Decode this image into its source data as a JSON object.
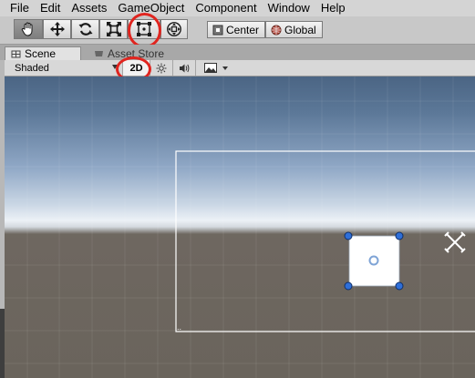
{
  "menu": [
    "File",
    "Edit",
    "Assets",
    "GameObject",
    "Component",
    "Window",
    "Help"
  ],
  "toolbar": {
    "tools": [
      {
        "name": "hand-tool-icon",
        "active": true
      },
      {
        "name": "move-tool-icon",
        "active": false
      },
      {
        "name": "rotate-tool-icon",
        "active": false
      },
      {
        "name": "scale-tool-icon",
        "active": false
      },
      {
        "name": "rect-tool-icon",
        "active": false
      },
      {
        "name": "transform-tool-icon",
        "active": false
      }
    ],
    "pivot_label": "Center",
    "space_label": "Global"
  },
  "tabs": [
    {
      "label": "Scene",
      "active": true
    },
    {
      "label": "Asset Store",
      "active": false
    }
  ],
  "scene_toolbar": {
    "shading_mode": "Shaded",
    "mode_2d_label": "2D",
    "mode_2d_active": true,
    "icons": [
      "light-icon",
      "audio-icon",
      "image-effects-icon"
    ]
  },
  "annotations": {
    "highlight_color": "#e0251f",
    "highlighted": [
      "rect-tool",
      "2d-toggle"
    ]
  },
  "colors": {
    "selection_handle": "#2f6fd8",
    "sprite_fill": "#ffffff"
  }
}
